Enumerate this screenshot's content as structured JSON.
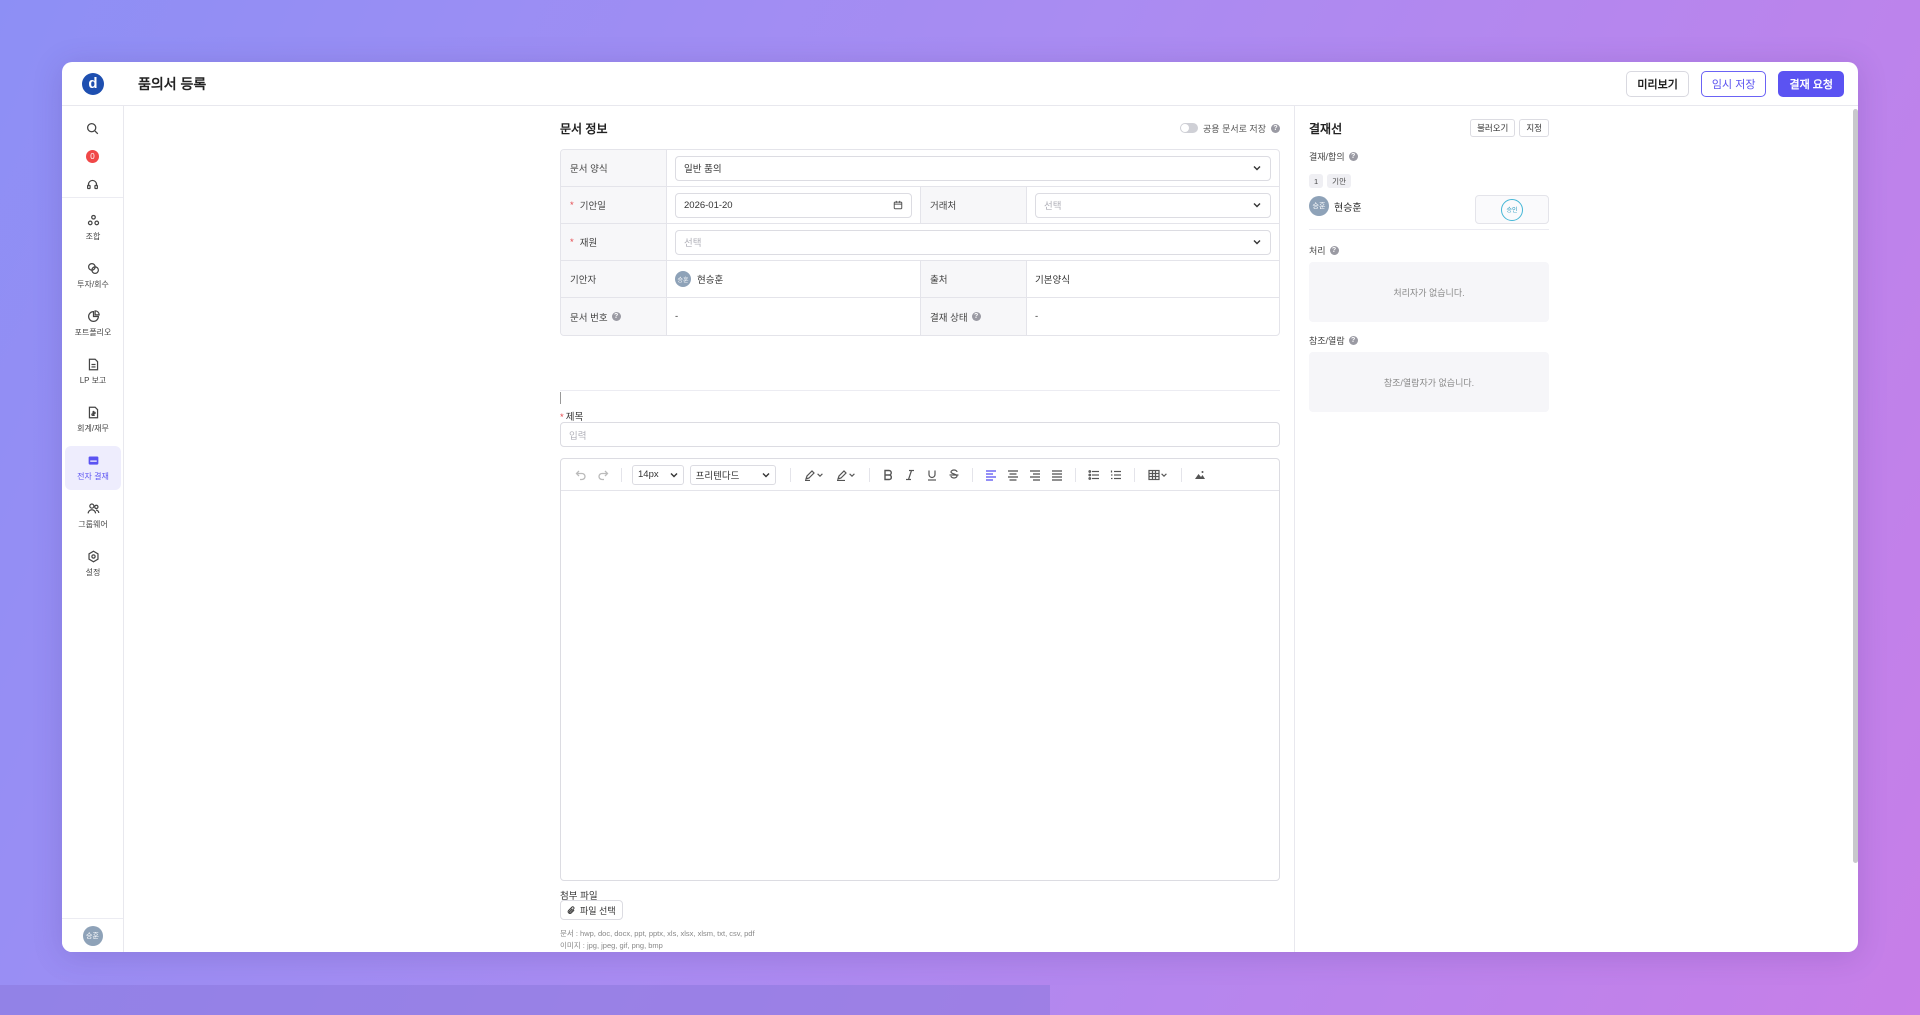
{
  "header": {
    "title": "품의서 등록",
    "preview_label": "미리보기",
    "temp_save_label": "임시 저장",
    "request_label": "결재 요청"
  },
  "sidebar": {
    "notification_count": "0",
    "items": [
      {
        "label": "조합",
        "icon": "union-icon"
      },
      {
        "label": "투자/회수",
        "icon": "investment-icon"
      },
      {
        "label": "포트폴리오",
        "icon": "portfolio-icon"
      },
      {
        "label": "LP 보고",
        "icon": "report-icon"
      },
      {
        "label": "회계/재무",
        "icon": "accounting-icon"
      },
      {
        "label": "전자 결재",
        "icon": "approval-icon"
      },
      {
        "label": "그룹웨어",
        "icon": "groupware-icon"
      },
      {
        "label": "설정",
        "icon": "settings-icon"
      }
    ],
    "user_initials": "승훈"
  },
  "doc_info": {
    "title": "문서 정보",
    "public_save_label": "공용 문서로 저장",
    "form_label": "문서 양식",
    "form_value": "일반 품의",
    "draft_date_label": "기안일",
    "draft_date_value": "2026-01-20",
    "client_label": "거래처",
    "client_placeholder": "선택",
    "fund_label": "재원",
    "fund_placeholder": "선택",
    "drafter_label": "기안자",
    "drafter_initials": "승훈",
    "drafter_name": "현승훈",
    "source_label": "출처",
    "source_value": "기본양식",
    "doc_no_label": "문서 번호",
    "doc_no_value": "-",
    "status_label": "결재 상태",
    "status_value": "-"
  },
  "subject": {
    "label": "제목",
    "placeholder": "입력"
  },
  "editor_toolbar": {
    "font_size": "14px",
    "font_family": "프리텐다드"
  },
  "attachment": {
    "label": "첨부 파일",
    "button_label": "파일 선택",
    "doc_types": "문서 : hwp, doc, docx, ppt, pptx, xls, xlsx, xlsm, txt, csv, pdf",
    "image_types": "이미지 : jpg, jpeg, gif, png, bmp"
  },
  "approval_line": {
    "title": "결재선",
    "load_label": "불러오기",
    "assign_label": "지정",
    "approve_section": "결재/합의",
    "step_number": "1",
    "step_type": "기안",
    "approver_initials": "승훈",
    "approver_name": "현승훈",
    "stamp_text": "승인",
    "process_section": "처리",
    "process_empty": "처리자가 없습니다.",
    "reference_section": "참조/열람",
    "reference_empty": "참조/열람자가 없습니다."
  }
}
